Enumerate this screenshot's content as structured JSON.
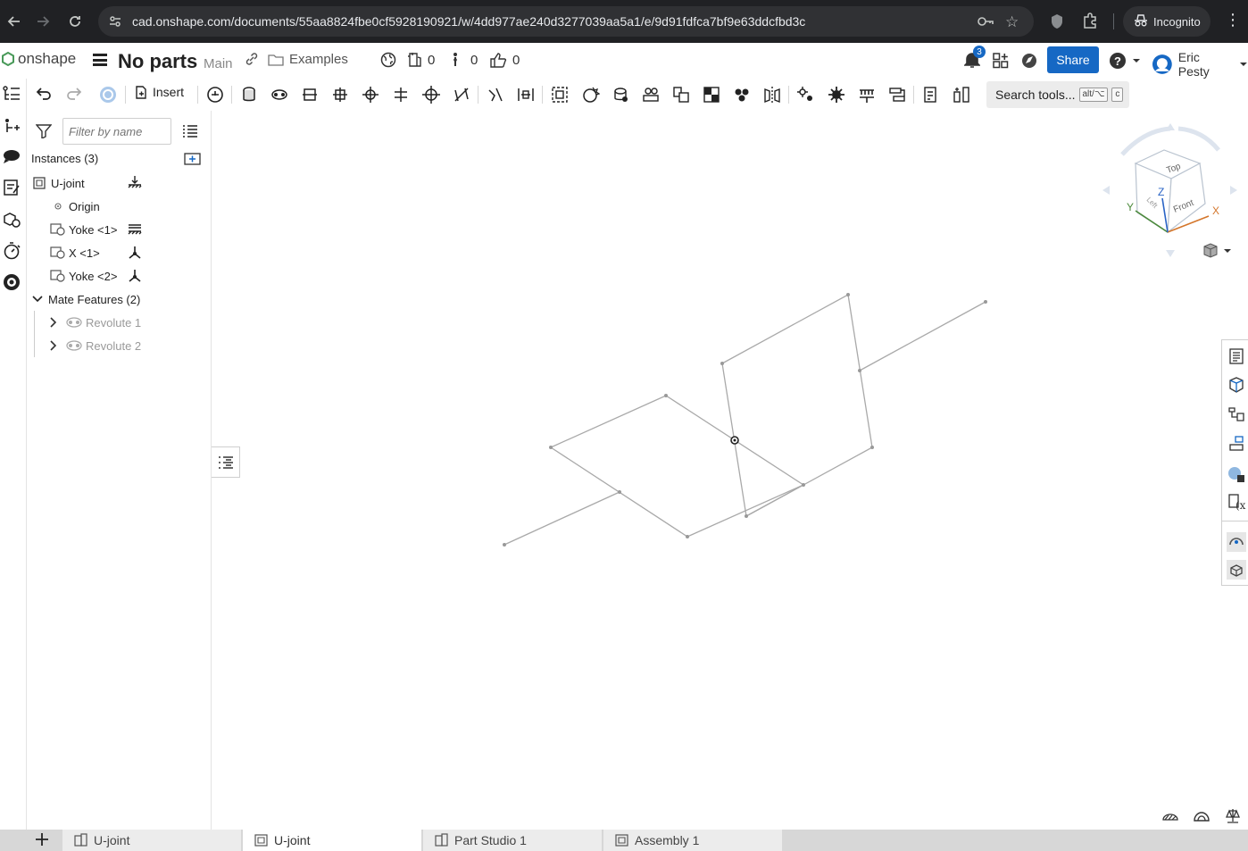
{
  "browser": {
    "url": "cad.onshape.com/documents/55aa8824fbe0cf5928190921/w/4dd977ae240d3277039aa5a1/e/9d91fdfca7bf9e63ddcfbd3c",
    "incognito_label": "Incognito"
  },
  "app": {
    "brand": "onshape",
    "doc_title": "No parts",
    "branch": "Main",
    "folder_label": "Examples",
    "version_count": "0",
    "branch_count": "0",
    "like_count": "0",
    "notifications": "3",
    "share_label": "Share",
    "user_name": "Eric Pesty"
  },
  "toolbar": {
    "insert_label": "Insert",
    "search_label": "Search tools...",
    "shortcut_mod": "alt/⌥",
    "shortcut_key": "c"
  },
  "instances": {
    "filter_placeholder": "Filter by name",
    "header": "Instances (3)",
    "items": [
      {
        "label": "U-joint"
      },
      {
        "label": "Origin"
      },
      {
        "label": "Yoke <1>"
      },
      {
        "label": "X <1>"
      },
      {
        "label": "Yoke <2>"
      }
    ],
    "mate_header": "Mate Features (2)",
    "mates": [
      {
        "label": "Revolute 1"
      },
      {
        "label": "Revolute 2"
      }
    ]
  },
  "view_cube": {
    "top": "Top",
    "front": "Front",
    "left": "Left",
    "axis_x": "X",
    "axis_y": "Y",
    "axis_z": "Z",
    "x_color": "#d4762b",
    "y_color": "#4c8a3c",
    "z_color": "#2a64c6"
  },
  "tabs": [
    {
      "label": "U-joint"
    },
    {
      "label": "U-joint"
    },
    {
      "label": "Part Studio 1"
    },
    {
      "label": "Assembly 1"
    }
  ],
  "colors": {
    "accent": "#1668c4",
    "chrome_bg": "#202124"
  }
}
